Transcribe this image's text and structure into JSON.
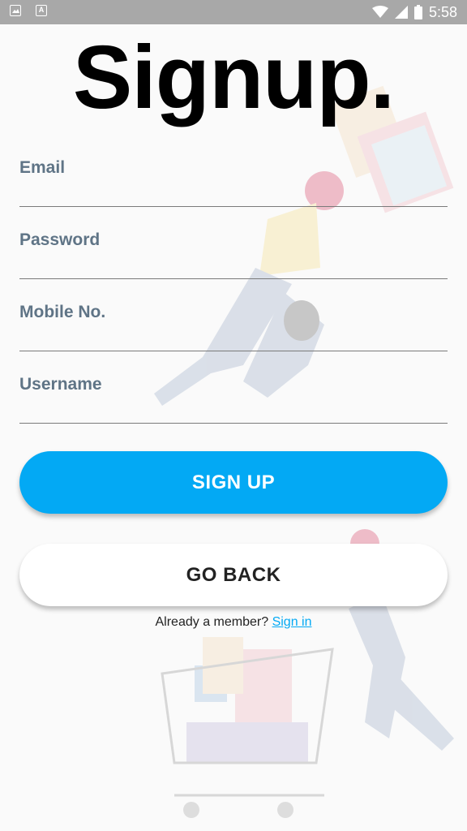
{
  "status_bar": {
    "time": "5:58",
    "icons": [
      "image-icon",
      "text-a-icon",
      "wifi-icon",
      "signal-icon",
      "battery-icon"
    ]
  },
  "page": {
    "title": "Signup."
  },
  "form": {
    "fields": [
      {
        "label": "Email"
      },
      {
        "label": "Password"
      },
      {
        "label": "Mobile No."
      },
      {
        "label": "Username"
      }
    ]
  },
  "actions": {
    "signup_label": "SIGN UP",
    "goback_label": "GO BACK"
  },
  "footer": {
    "prompt": "Already a member? ",
    "link": "Sign in"
  },
  "colors": {
    "accent": "#03a9f4",
    "label": "#5f7486"
  }
}
